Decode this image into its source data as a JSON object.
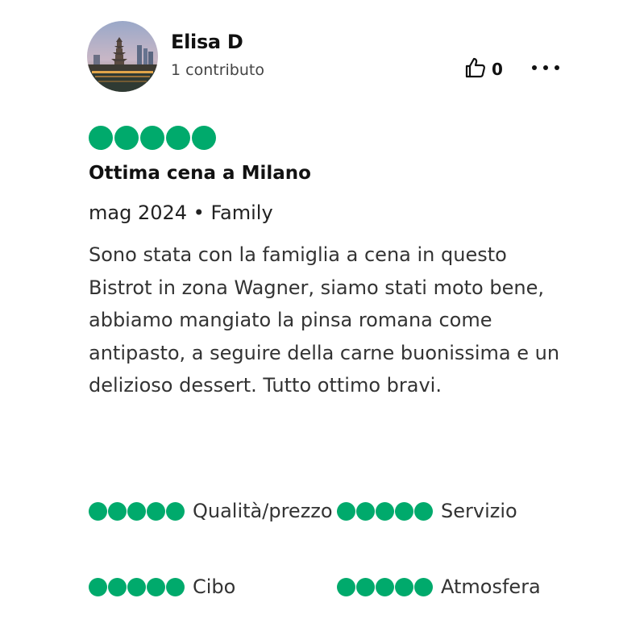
{
  "review": {
    "user": {
      "name": "Elisa D",
      "contributions": "1 contributo",
      "avatar_icon": "avatar-city-skyline"
    },
    "helpful": {
      "icon": "thumbs-up-icon",
      "count": "0"
    },
    "more_icon": "more-dots-icon",
    "rating": 5,
    "rating_max": 5,
    "title": "Ottima cena a Milano",
    "meta": "mag 2024 • Family",
    "body": "Sono stata con la famiglia a cena in questo Bistrot in zona Wagner, siamo stati moto bene, abbiamo mangiato la pinsa romana come antipasto, a seguire della carne buonissima e un delizioso dessert. Tutto ottimo bravi.",
    "sub_ratings": [
      {
        "label": "Qualità/prezzo",
        "value": 5
      },
      {
        "label": "Servizio",
        "value": 5
      },
      {
        "label": "Cibo",
        "value": 5
      },
      {
        "label": "Atmosfera",
        "value": 5
      }
    ]
  },
  "colors": {
    "bubble": "#00aa6c",
    "text": "#222222"
  }
}
